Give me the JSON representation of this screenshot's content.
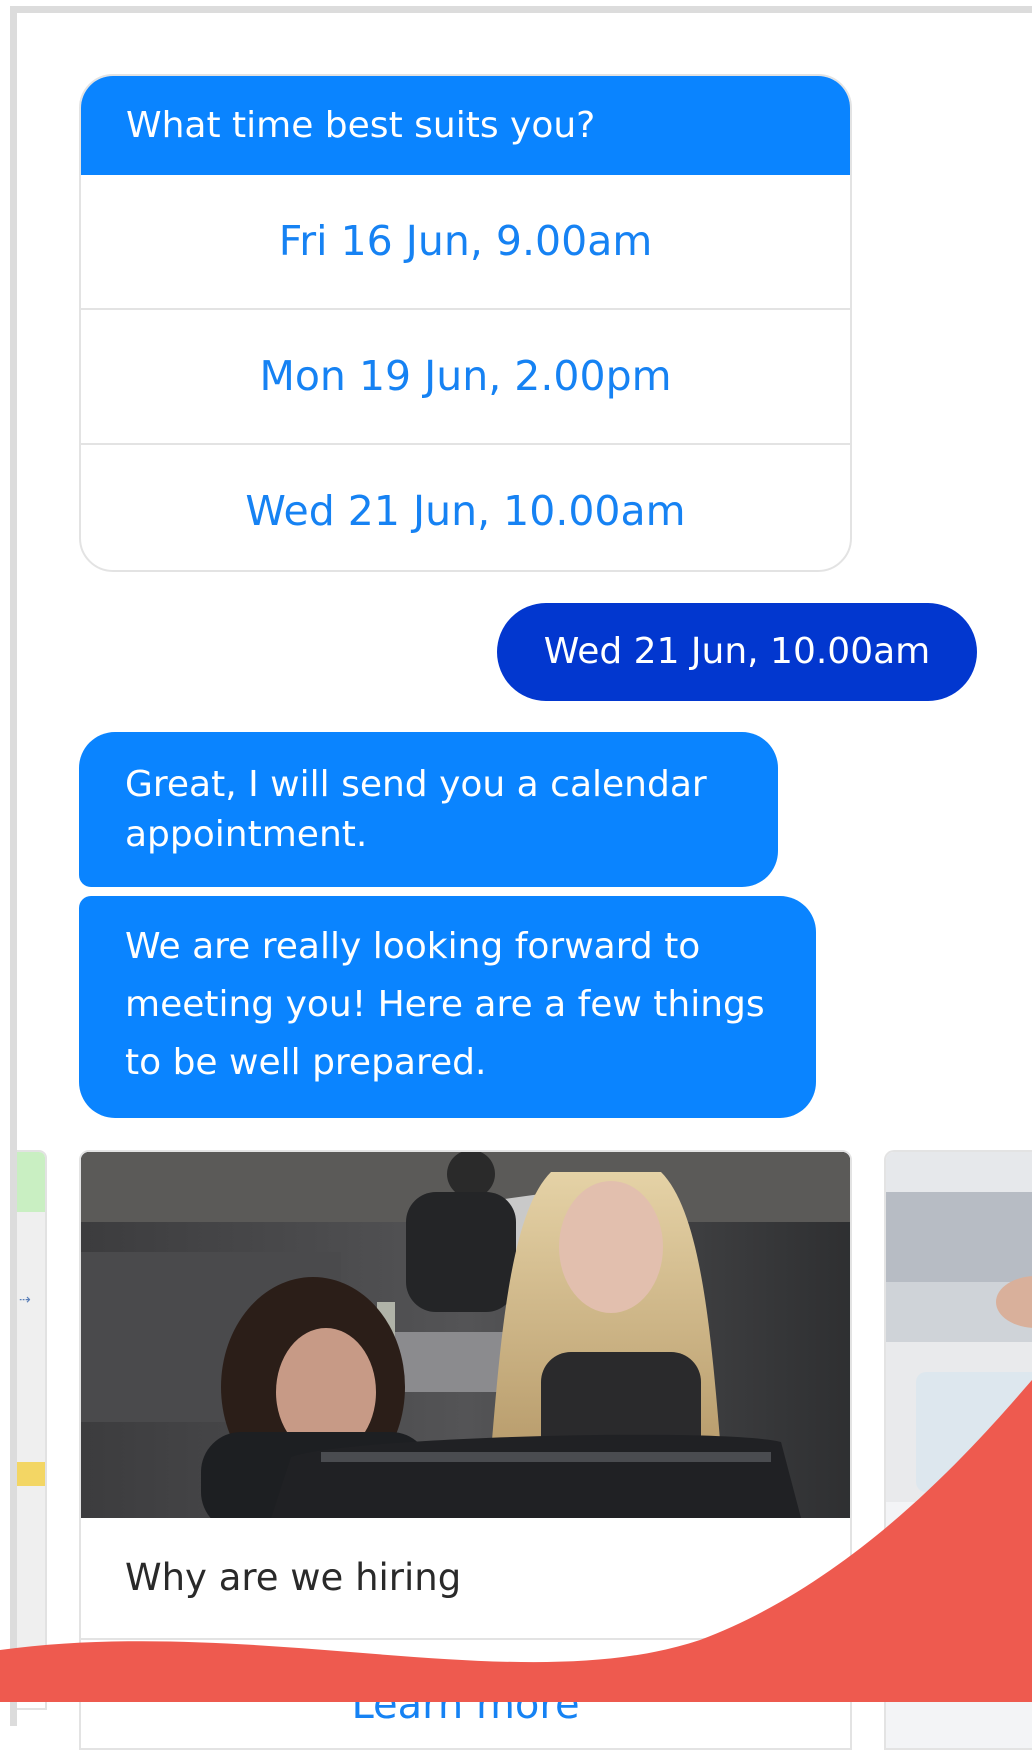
{
  "chat": {
    "question_card": {
      "header": "What time best suits you?",
      "options": [
        {
          "label": "Fri 16 Jun, 9.00am"
        },
        {
          "label": "Mon 19 Jun, 2.00pm"
        },
        {
          "label": "Wed 21 Jun, 10.00am"
        }
      ]
    },
    "user_reply": "Wed 21 Jun, 10.00am",
    "bot_messages": [
      {
        "text": "Great, I will send you a calendar appointment."
      },
      {
        "text": "We are really looking forward to meeting you! Here are a few things to be well prepared."
      }
    ]
  },
  "carousel": {
    "cards": [
      {
        "title": "Why are we hiring",
        "link_label": "Learn more"
      }
    ]
  },
  "colors": {
    "bot_bubble": "#0a84ff",
    "user_bubble": "#0237cf",
    "option_text": "#1682f3",
    "accent_coral": "#ee5a4f"
  }
}
